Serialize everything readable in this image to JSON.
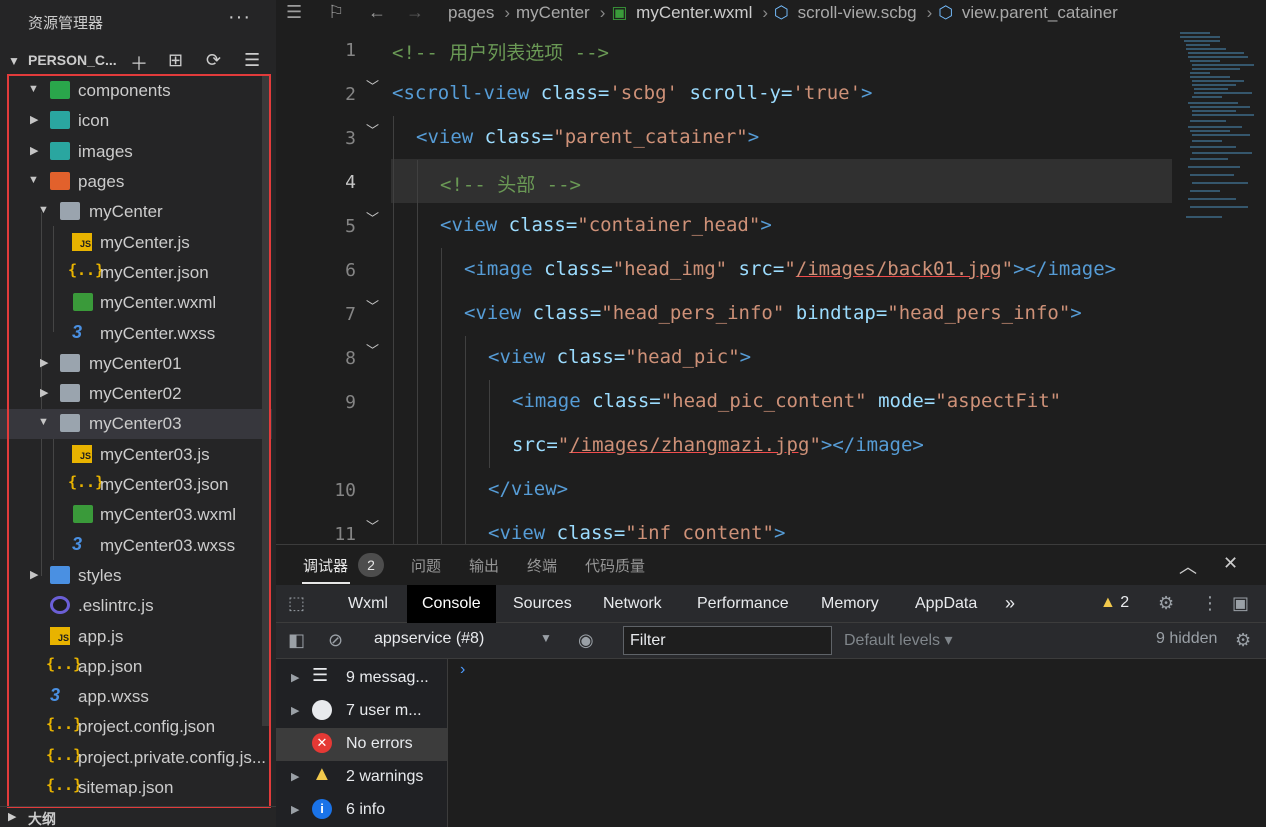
{
  "explorer": {
    "title": "资源管理器",
    "more": "···",
    "project": "PERSON_C...",
    "outline": "大纲"
  },
  "tree": [
    {
      "label": "components",
      "type": "folder",
      "color": "#2aa64b",
      "expanded": true
    },
    {
      "label": "icon",
      "type": "folder",
      "color": "#2aa6a0",
      "expanded": false
    },
    {
      "label": "images",
      "type": "folder",
      "color": "#2aa6a0",
      "expanded": false
    },
    {
      "label": "pages",
      "type": "folder",
      "color": "#e2612c",
      "expanded": true
    },
    {
      "label": "myCenter",
      "type": "folder",
      "color": "#9aa4ae",
      "expanded": true
    },
    {
      "label": "myCenter.js",
      "type": "js"
    },
    {
      "label": "myCenter.json",
      "type": "json"
    },
    {
      "label": "myCenter.wxml",
      "type": "wxml"
    },
    {
      "label": "myCenter.wxss",
      "type": "wxss"
    },
    {
      "label": "myCenter01",
      "type": "folder",
      "color": "#9aa4ae",
      "expanded": false
    },
    {
      "label": "myCenter02",
      "type": "folder",
      "color": "#9aa4ae",
      "expanded": false
    },
    {
      "label": "myCenter03",
      "type": "folder",
      "color": "#9aa4ae",
      "expanded": true,
      "selected": true
    },
    {
      "label": "myCenter03.js",
      "type": "js"
    },
    {
      "label": "myCenter03.json",
      "type": "json"
    },
    {
      "label": "myCenter03.wxml",
      "type": "wxml"
    },
    {
      "label": "myCenter03.wxss",
      "type": "wxss"
    },
    {
      "label": "styles",
      "type": "folder",
      "color": "#4a90e2",
      "expanded": false
    },
    {
      "label": ".eslintrc.js",
      "type": "eslint"
    },
    {
      "label": "app.js",
      "type": "js"
    },
    {
      "label": "app.json",
      "type": "json"
    },
    {
      "label": "app.wxss",
      "type": "wxss"
    },
    {
      "label": "project.config.json",
      "type": "json"
    },
    {
      "label": "project.private.config.js...",
      "type": "json"
    },
    {
      "label": "sitemap.json",
      "type": "json"
    }
  ],
  "breadcrumb": {
    "pages": "pages",
    "folder": "myCenter",
    "file": "myCenter.wxml",
    "node1": "scroll-view.scbg",
    "node2": "view.parent_catainer"
  },
  "editor": {
    "line_numbers": [
      "1",
      "2",
      "3",
      "4",
      "5",
      "6",
      "7",
      "8",
      "9",
      "10",
      "11"
    ],
    "active_line": "4",
    "code": {
      "l1": "<!-- 用户列表选项 -->",
      "l2_tag": "<scroll-view",
      "l2_a1": " class=",
      "l2_v1": "'scbg'",
      "l2_a2": " scroll-y=",
      "l2_v2": "'true'",
      "l2_end": ">",
      "l3_tag": "<view",
      "l3_a1": " class=",
      "l3_v1": "\"parent_catainer\"",
      "l3_end": ">",
      "l4": "<!-- 头部 -->",
      "l5_tag": "<view",
      "l5_a1": " class=",
      "l5_v1": "\"container_head\"",
      "l5_end": ">",
      "l6_tag": "<image",
      "l6_a1": " class=",
      "l6_v1": "\"head_img\"",
      "l6_a2": " src=",
      "l6_q1": "\"",
      "l6_link": "/images/back01.jpg",
      "l6_q2": "\"",
      "l6_end": "></image>",
      "l7_tag": "<view",
      "l7_a1": " class=",
      "l7_v1": "\"head_pers_info\"",
      "l7_a2": " bindtap=",
      "l7_v2": "\"head_pers_info\"",
      "l7_end": ">",
      "l8_tag": "<view",
      "l8_a1": " class=",
      "l8_v1": "\"head_pic\"",
      "l8_end": ">",
      "l9_tag": "<image",
      "l9_a1": " class=",
      "l9_v1": "\"head_pic_content\"",
      "l9_a2": " mode=",
      "l9_v2": "\"aspectFit\"",
      "l9b_a": "src=",
      "l9b_q1": "\"",
      "l9b_link": "/images/zhangmazi.jpg",
      "l9b_q2": "\"",
      "l9b_end": "></image>",
      "l10": "</view>",
      "l11_tag": "<view",
      "l11_a1": " class=",
      "l11_v1": "\"inf content\"",
      "l11_end": ">"
    }
  },
  "panel": {
    "tabs": [
      "调试器",
      "问题",
      "输出",
      "终端",
      "代码质量"
    ],
    "debugger_count": "2"
  },
  "devtools": {
    "tabs": [
      "Wxml",
      "Console",
      "Sources",
      "Network",
      "Performance",
      "Memory",
      "AppData"
    ],
    "active": "Console",
    "warnings": "2"
  },
  "console": {
    "context": "appservice (#8)",
    "filter_placeholder": "Filter",
    "levels": "Default levels",
    "hidden": "9 hidden",
    "side": [
      {
        "label": "9 messag...",
        "icon": "list-icon"
      },
      {
        "label": "7 user m...",
        "icon": "user-icon"
      },
      {
        "label": "No errors",
        "icon": "error-icon"
      },
      {
        "label": "2 warnings",
        "icon": "warning-icon"
      },
      {
        "label": "6 info",
        "icon": "info-icon"
      }
    ]
  },
  "colors": {
    "selection_box": "#e23b3b",
    "tag": "#569cd6",
    "attr": "#9cdcfe",
    "string": "#ce9178",
    "comment": "#6a9955"
  }
}
